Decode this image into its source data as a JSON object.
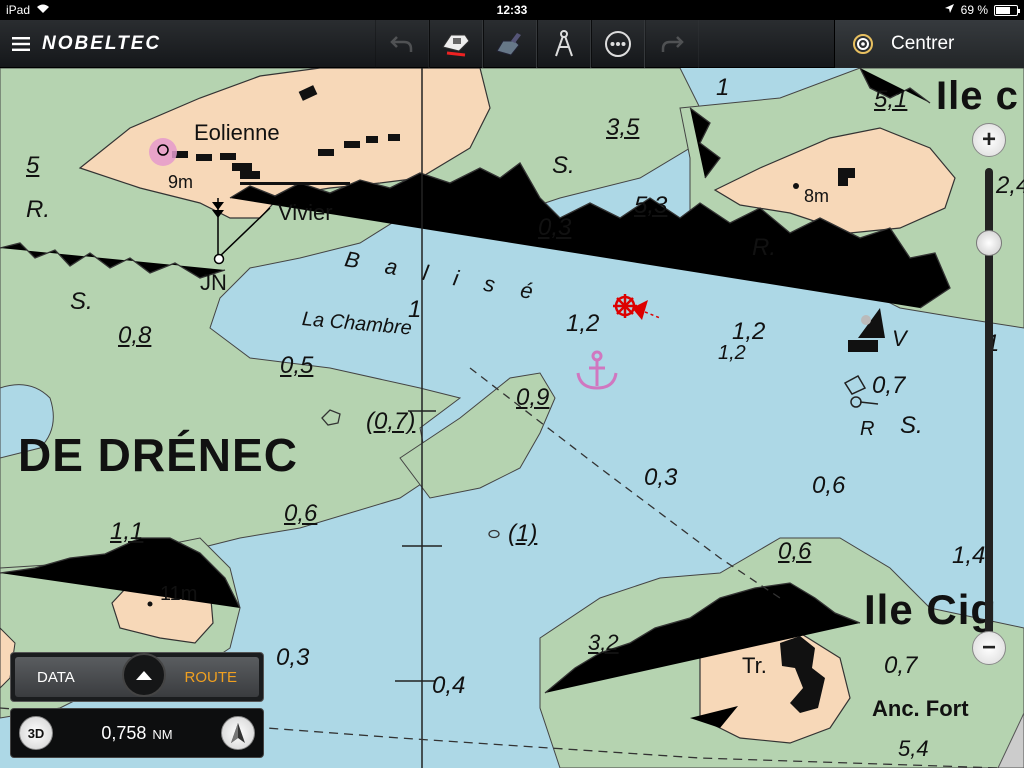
{
  "status": {
    "device": "iPad",
    "time": "12:33",
    "battery": "69 %"
  },
  "toolbar": {
    "logo": "NOBELTEC",
    "center_label": "Centrer"
  },
  "map": {
    "places": {
      "drenec": "DE DRÉNEC",
      "ile_top": "Ile c",
      "ile_cig": "Ile Cig"
    },
    "features": {
      "eolienne": "Eolienne",
      "vivier": "Vivier",
      "balise": "B a l i s é",
      "chambre": "La Chambre",
      "jn": "JN",
      "h9m": "9m",
      "h8m": "8m",
      "h11m": "11m",
      "tr": "Tr.",
      "anc_fort": "Anc. Fort",
      "s1": "S.",
      "s2": "S.",
      "s3": "S.",
      "r1": "R.",
      "r2": "R.",
      "r3": "R",
      "v": "V"
    },
    "depths": {
      "d5": "5",
      "d1top": "1",
      "d51": "5,1",
      "d35": "3,5",
      "d53": "5,3",
      "d03": "0,3",
      "d24": "2,4",
      "d08": "0,8",
      "d05": "0,5",
      "d1": "1",
      "d12a": "1,2",
      "d12b": "1,2",
      "d12c": "1,2",
      "d07a": "0,7",
      "d07p": "(0,7)",
      "d09": "0,9",
      "d03b": "0,3",
      "d06a": "0,6",
      "d06b": "0,6",
      "d06c": "0,6",
      "d11": "1,1",
      "d1p": "(1)",
      "d14": "1,4",
      "d32": "3,2",
      "d03c": "0,3",
      "d04": "0,4",
      "d07b": "0,7",
      "d54": "5,4",
      "d1r": "1"
    }
  },
  "zoom": {
    "plus": "+",
    "minus": "−"
  },
  "panel": {
    "data": "DATA",
    "route": "ROUTE",
    "mode3d": "3D",
    "distance": "0,758",
    "unit": "NM"
  }
}
